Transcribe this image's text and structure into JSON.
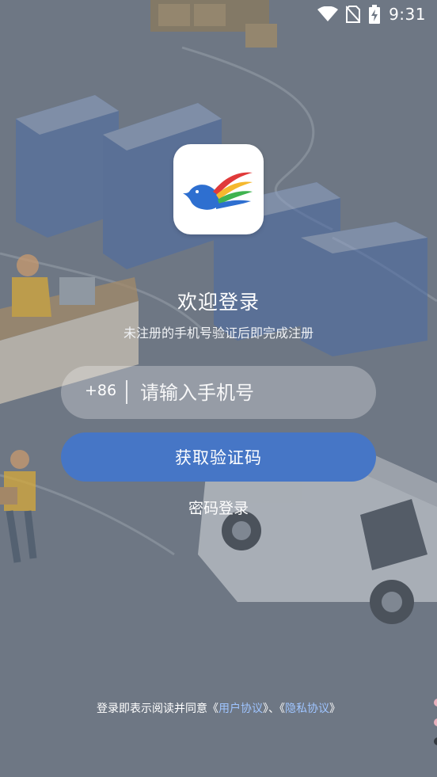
{
  "status_bar": {
    "time": "9:31",
    "icons": [
      "wifi-icon",
      "no-sim-icon",
      "battery-charging-icon"
    ]
  },
  "logo": {
    "icon": "bird-logo-icon",
    "colors": [
      "#2e6fd0",
      "#e03a3a",
      "#f5b82e",
      "#3fb34f"
    ]
  },
  "login": {
    "title": "欢迎登录",
    "subtitle": "未注册的手机号验证后即完成注册",
    "country_code": "+86",
    "phone_placeholder": "请输入手机号",
    "phone_value": "",
    "get_code_label": "获取验证码",
    "password_login_label": "密码登录"
  },
  "agreement": {
    "prefix": "登录即表示阅读并同意",
    "open_quote_1": "《",
    "user_agreement": "用户协议",
    "close_quote_1": "》",
    "separator": "、",
    "open_quote_2": "《",
    "privacy_policy": "隐私协议",
    "close_quote_2": "》"
  },
  "colors": {
    "background": "#6e7784",
    "primary_button": "#4676c6",
    "link": "#9ec4ff"
  }
}
